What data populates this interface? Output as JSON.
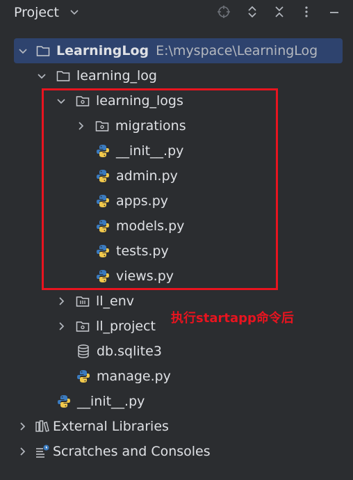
{
  "header": {
    "title": "Project",
    "icons": [
      "target-icon",
      "expand-collapse-icon",
      "collapse-all-icon",
      "more-options-icon",
      "minimize-icon"
    ]
  },
  "tree": {
    "root": {
      "name": "LearningLog",
      "path": "E:\\myspace\\LearningLog"
    },
    "learning_log": "learning_log",
    "learning_logs": "learning_logs",
    "migrations": "migrations",
    "init_app": "__init__.py",
    "admin": "admin.py",
    "apps": "apps.py",
    "models": "models.py",
    "tests": "tests.py",
    "views": "views.py",
    "ll_env": "ll_env",
    "ll_project": "ll_project",
    "db": "db.sqlite3",
    "manage": "manage.py",
    "init_root": "__init__.py",
    "external_libraries": "External Libraries",
    "scratches": "Scratches and Consoles"
  },
  "annotation": "执行startapp命令后",
  "colors": {
    "background": "#2b2d30",
    "selected_row": "#2e436e",
    "text": "#dfe1e5",
    "annotation_red": "#e8141f",
    "python_blue": "#3b7bbf",
    "python_yellow": "#f2c94c"
  }
}
